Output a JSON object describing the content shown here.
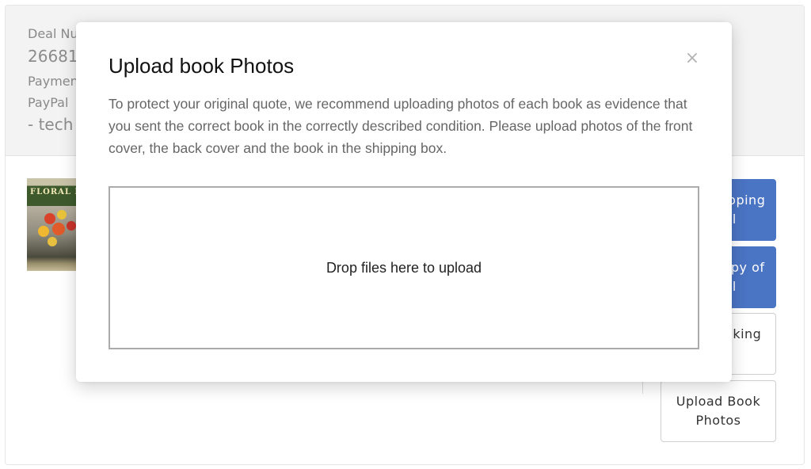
{
  "deal": {
    "number_label": "Deal Number",
    "number_value": "26681",
    "payment_label": "Payment",
    "payment_method": "PayPal",
    "payment_account": "- tech"
  },
  "book": {
    "cover_title": "FLORAL DE"
  },
  "actions": {
    "print_shipping_label": "Print Shipping Label",
    "email_label_copy": "Email Copy of Label",
    "add_tracking": "Add Tracking Info",
    "upload_photos": "Upload Book Photos"
  },
  "modal": {
    "title": "Upload book Photos",
    "close_icon": "×",
    "description": "To protect your original quote, we recommend uploading photos of each book as evidence that you sent the correct book in the correctly described condition. Please upload photos of the front cover, the back cover and the book in the shipping box.",
    "dropzone_text": "Drop files here to upload"
  },
  "colors": {
    "primary_button": "#4a74c4",
    "header_bg": "#f3f3f3"
  }
}
